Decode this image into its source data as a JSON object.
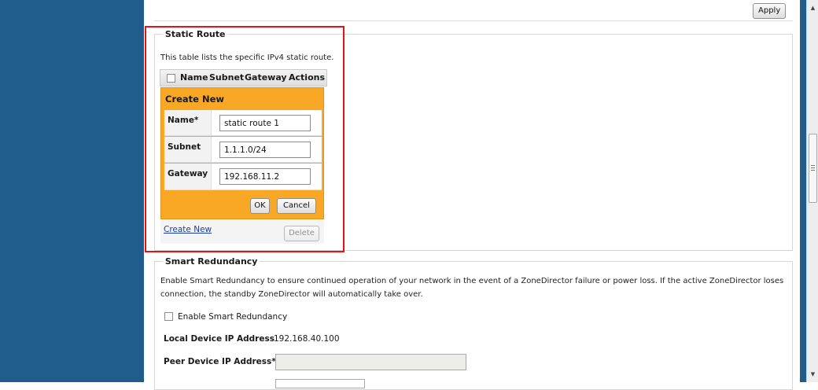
{
  "top": {
    "apply_label": "Apply"
  },
  "static_route": {
    "legend": "Static Route",
    "description": "This table lists the specific IPv4 static route.",
    "columns": [
      "Name",
      "Subnet",
      "Gateway",
      "Actions"
    ],
    "create_panel": {
      "title": "Create New",
      "fields": [
        {
          "label": "Name*",
          "value": "static route 1"
        },
        {
          "label": "Subnet",
          "value": "1.1.1.0/24"
        },
        {
          "label": "Gateway",
          "value": "192.168.11.2"
        }
      ],
      "ok_label": "OK",
      "cancel_label": "Cancel"
    },
    "create_new_link": "Create New",
    "delete_label": "Delete"
  },
  "smart_redundancy": {
    "legend": "Smart Redundancy",
    "description": "Enable Smart Redundancy to ensure continued operation of your network in the event of a ZoneDirector failure or power loss. If the active ZoneDirector loses connection, the standby ZoneDirector will automatically take over.",
    "enable_label": "Enable Smart Redundancy",
    "local_ip_label": "Local Device IP Address",
    "local_ip_value": "192.168.40.100",
    "peer_ip_label": "Peer Device IP Address*",
    "peer_ip_value": ""
  },
  "colors": {
    "sidebar": "#215d8c",
    "panel": "#f9a826",
    "highlight": "#e4121b"
  }
}
